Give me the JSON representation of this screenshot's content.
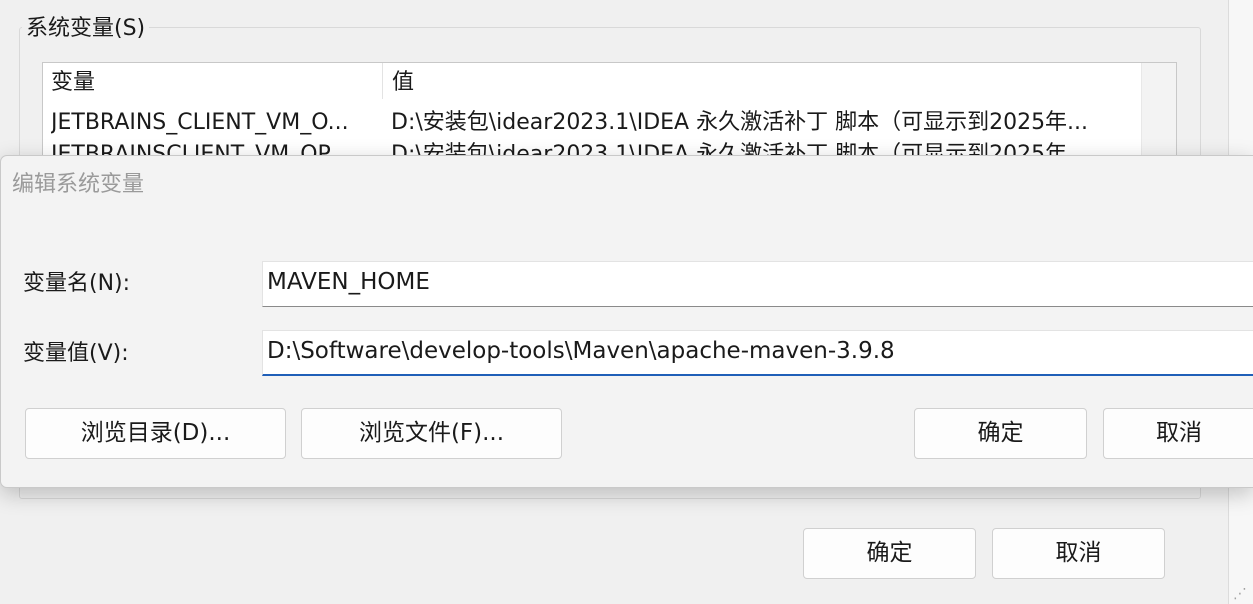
{
  "background_window": {
    "group_title": "系统变量(S)",
    "table": {
      "columns": [
        "变量",
        "值"
      ],
      "rows": [
        {
          "name": "JETBRAINS_CLIENT_VM_O...",
          "value": "D:\\安装包\\idear2023.1\\IDEA 永久激活补丁 脚本（可显示到2025年..."
        },
        {
          "name": "JETBRAINSCLIENT_VM_OP...",
          "value": "D:\\安装包\\idear2023.1\\IDEA 永久激活补丁 脚本（可显示到2025年..."
        }
      ]
    },
    "ok_label": "确定",
    "cancel_label": "取消"
  },
  "dialog": {
    "title": "编辑系统变量",
    "name_label": "变量名(N):",
    "name_value": "MAVEN_HOME",
    "value_label": "变量值(V):",
    "value_value": "D:\\Software\\develop-tools\\Maven\\apache-maven-3.9.8",
    "browse_dir_label": "浏览目录(D)...",
    "browse_file_label": "浏览文件(F)...",
    "ok_label": "确定",
    "cancel_label": "取消"
  }
}
